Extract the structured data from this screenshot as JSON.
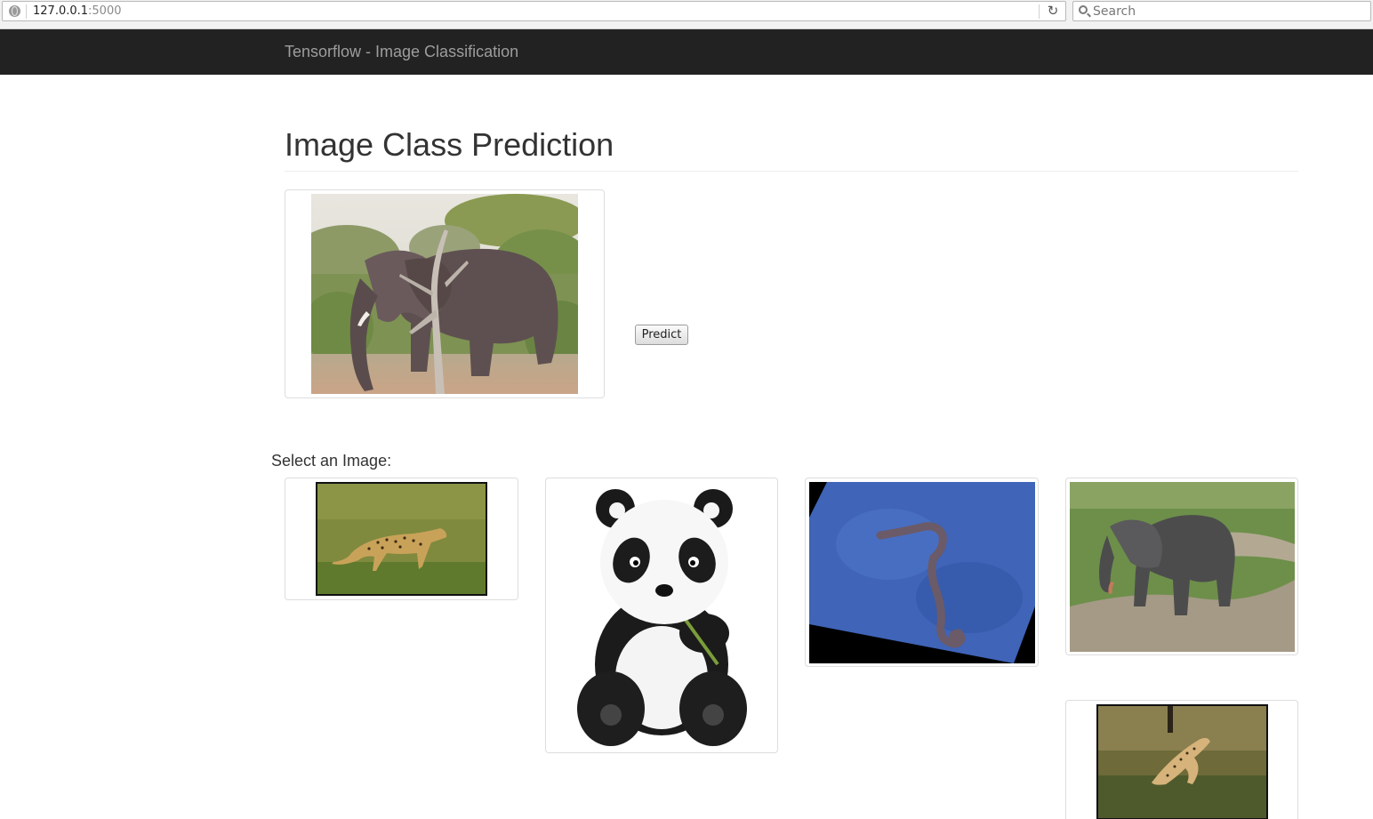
{
  "browser": {
    "url_host": "127.0.0.1",
    "url_port": ":5000",
    "search_placeholder": "Search"
  },
  "navbar": {
    "brand": "Tensorflow - Image Classification"
  },
  "main": {
    "title": "Image Class Prediction",
    "predict_label": "Predict",
    "select_label": "Select an Image:"
  },
  "gallery": [
    {
      "name": "cheetah-walking"
    },
    {
      "name": "panda"
    },
    {
      "name": "seahorse"
    },
    {
      "name": "elephant-walking"
    },
    {
      "name": "cheetah-running"
    }
  ],
  "selected_image": {
    "name": "elephant"
  }
}
